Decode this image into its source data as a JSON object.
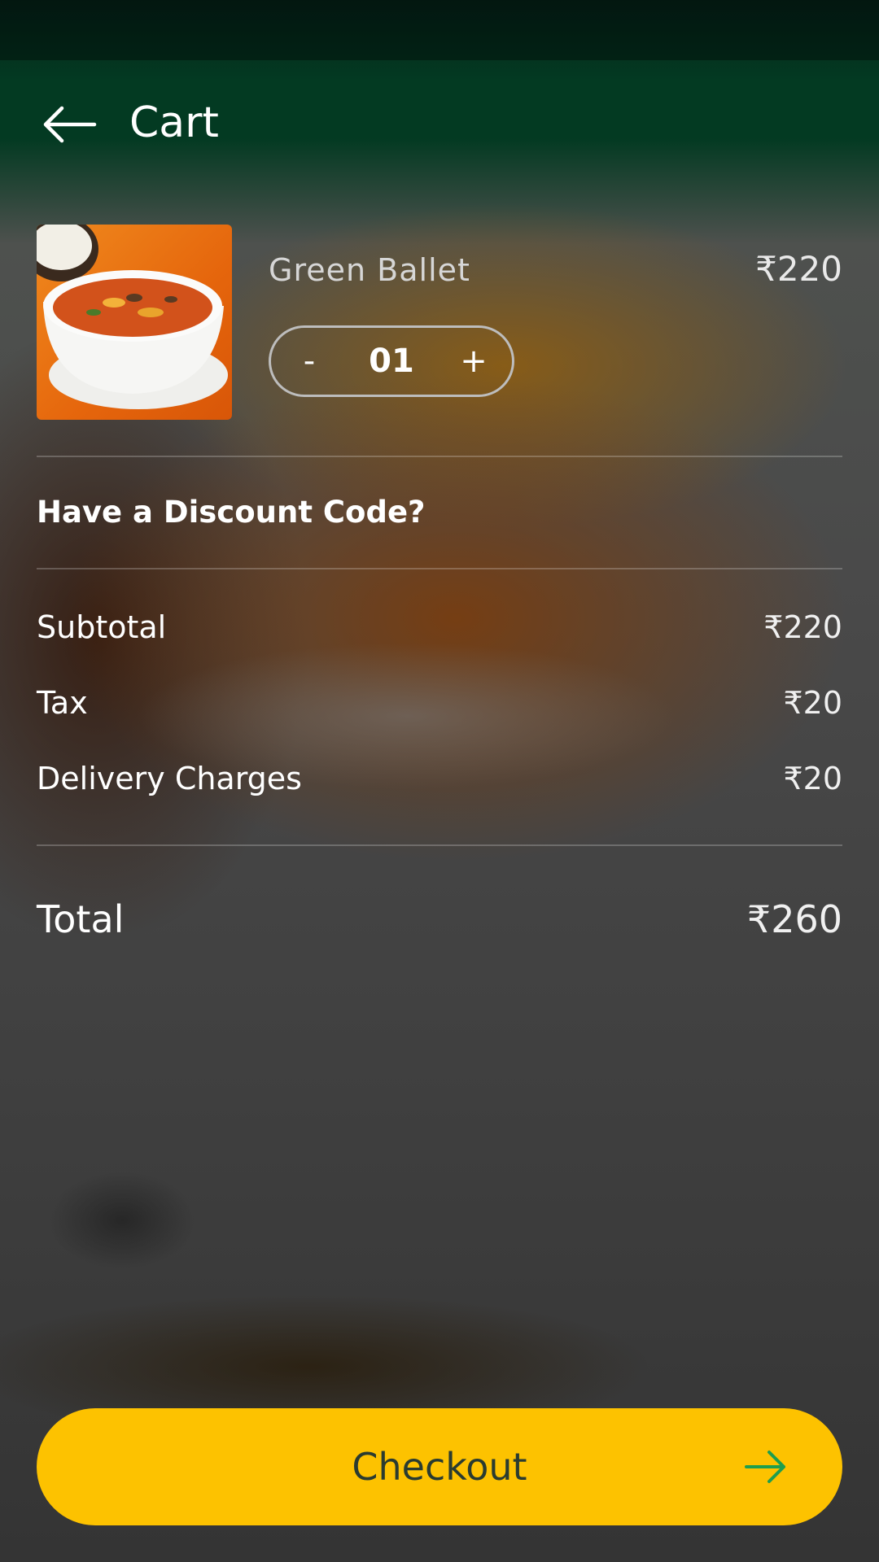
{
  "header": {
    "title": "Cart"
  },
  "cart_item": {
    "name": "Green Ballet",
    "price": "₹220",
    "quantity": "01",
    "decrement_label": "-",
    "increment_label": "+"
  },
  "discount": {
    "label": "Have a Discount Code?"
  },
  "summary": {
    "subtotal_label": "Subtotal",
    "subtotal_value": "₹220",
    "tax_label": "Tax",
    "tax_value": "₹20",
    "delivery_label": "Delivery Charges",
    "delivery_value": "₹20",
    "total_label": "Total",
    "total_value": "₹260"
  },
  "checkout": {
    "label": "Checkout"
  },
  "colors": {
    "header_green": "#033a22",
    "checkout_yellow": "#fdc200",
    "arrow_green": "#1e9e4e"
  },
  "icons": {
    "back": "arrow-left-icon",
    "checkout": "arrow-right-icon"
  }
}
